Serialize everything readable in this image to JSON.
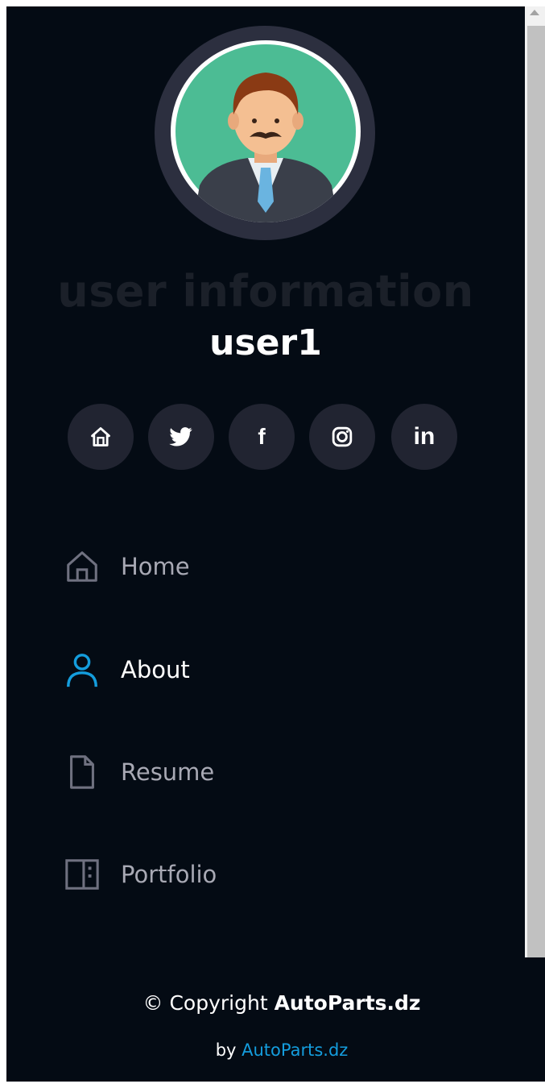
{
  "profile": {
    "section_title": "user information",
    "username": "user1"
  },
  "social_links": [
    {
      "name": "home",
      "icon": "home-icon"
    },
    {
      "name": "twitter",
      "icon": "twitter-icon"
    },
    {
      "name": "facebook",
      "icon": "facebook-icon",
      "glyph": "f"
    },
    {
      "name": "instagram",
      "icon": "instagram-icon"
    },
    {
      "name": "linkedin",
      "icon": "linkedin-icon",
      "glyph": "in"
    }
  ],
  "nav": {
    "items": [
      {
        "label": "Home",
        "icon": "home-outline-icon",
        "active": false
      },
      {
        "label": "About",
        "icon": "person-icon",
        "active": true
      },
      {
        "label": "Resume",
        "icon": "file-icon",
        "active": false
      },
      {
        "label": "Portfolio",
        "icon": "layout-icon",
        "active": false
      }
    ]
  },
  "footer": {
    "copyright_prefix": "© Copyright ",
    "copyright_brand": "AutoParts.dz",
    "credit_prefix": "by ",
    "credit_link": "AutoParts.dz"
  },
  "colors": {
    "background": "#040b14",
    "accent": "#149ddd",
    "social_bg": "#212431",
    "nav_text": "#a8a9b4"
  }
}
